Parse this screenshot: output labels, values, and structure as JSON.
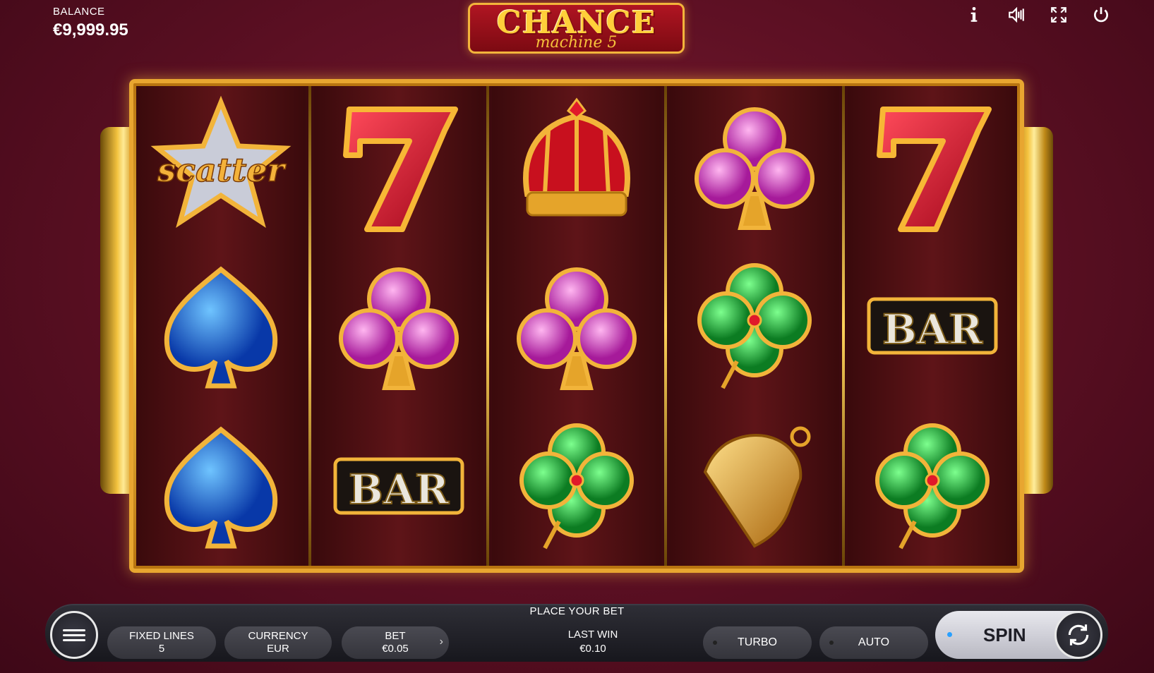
{
  "balance": {
    "label": "BALANCE",
    "value": "€9,999.95"
  },
  "logo": {
    "title": "CHANCE",
    "subtitle": "machine 5"
  },
  "top_icons": [
    "info-icon",
    "sound-icon",
    "fullscreen-icon",
    "power-icon"
  ],
  "reels": [
    [
      "scatter",
      "spade",
      "spade"
    ],
    [
      "seven",
      "club",
      "bar"
    ],
    [
      "crown",
      "club",
      "clover"
    ],
    [
      "club",
      "clover",
      "bell"
    ],
    [
      "seven",
      "bar",
      "clover"
    ]
  ],
  "symbol_text": {
    "scatter": "scatter",
    "bar": "BAR",
    "seven": "7"
  },
  "status": "PLACE YOUR BET",
  "controls": {
    "fixed_lines": {
      "label": "FIXED LINES",
      "value": "5"
    },
    "currency": {
      "label": "CURRENCY",
      "value": "EUR"
    },
    "bet": {
      "label": "BET",
      "value": "€0.05"
    },
    "last_win": {
      "label": "LAST WIN",
      "value": "€0.10"
    },
    "turbo": "TURBO",
    "auto": "AUTO",
    "spin": "SPIN"
  },
  "colors": {
    "gold": "#f3b43b",
    "background": "#5a0f22",
    "spin_dot": "#29a0ff"
  }
}
